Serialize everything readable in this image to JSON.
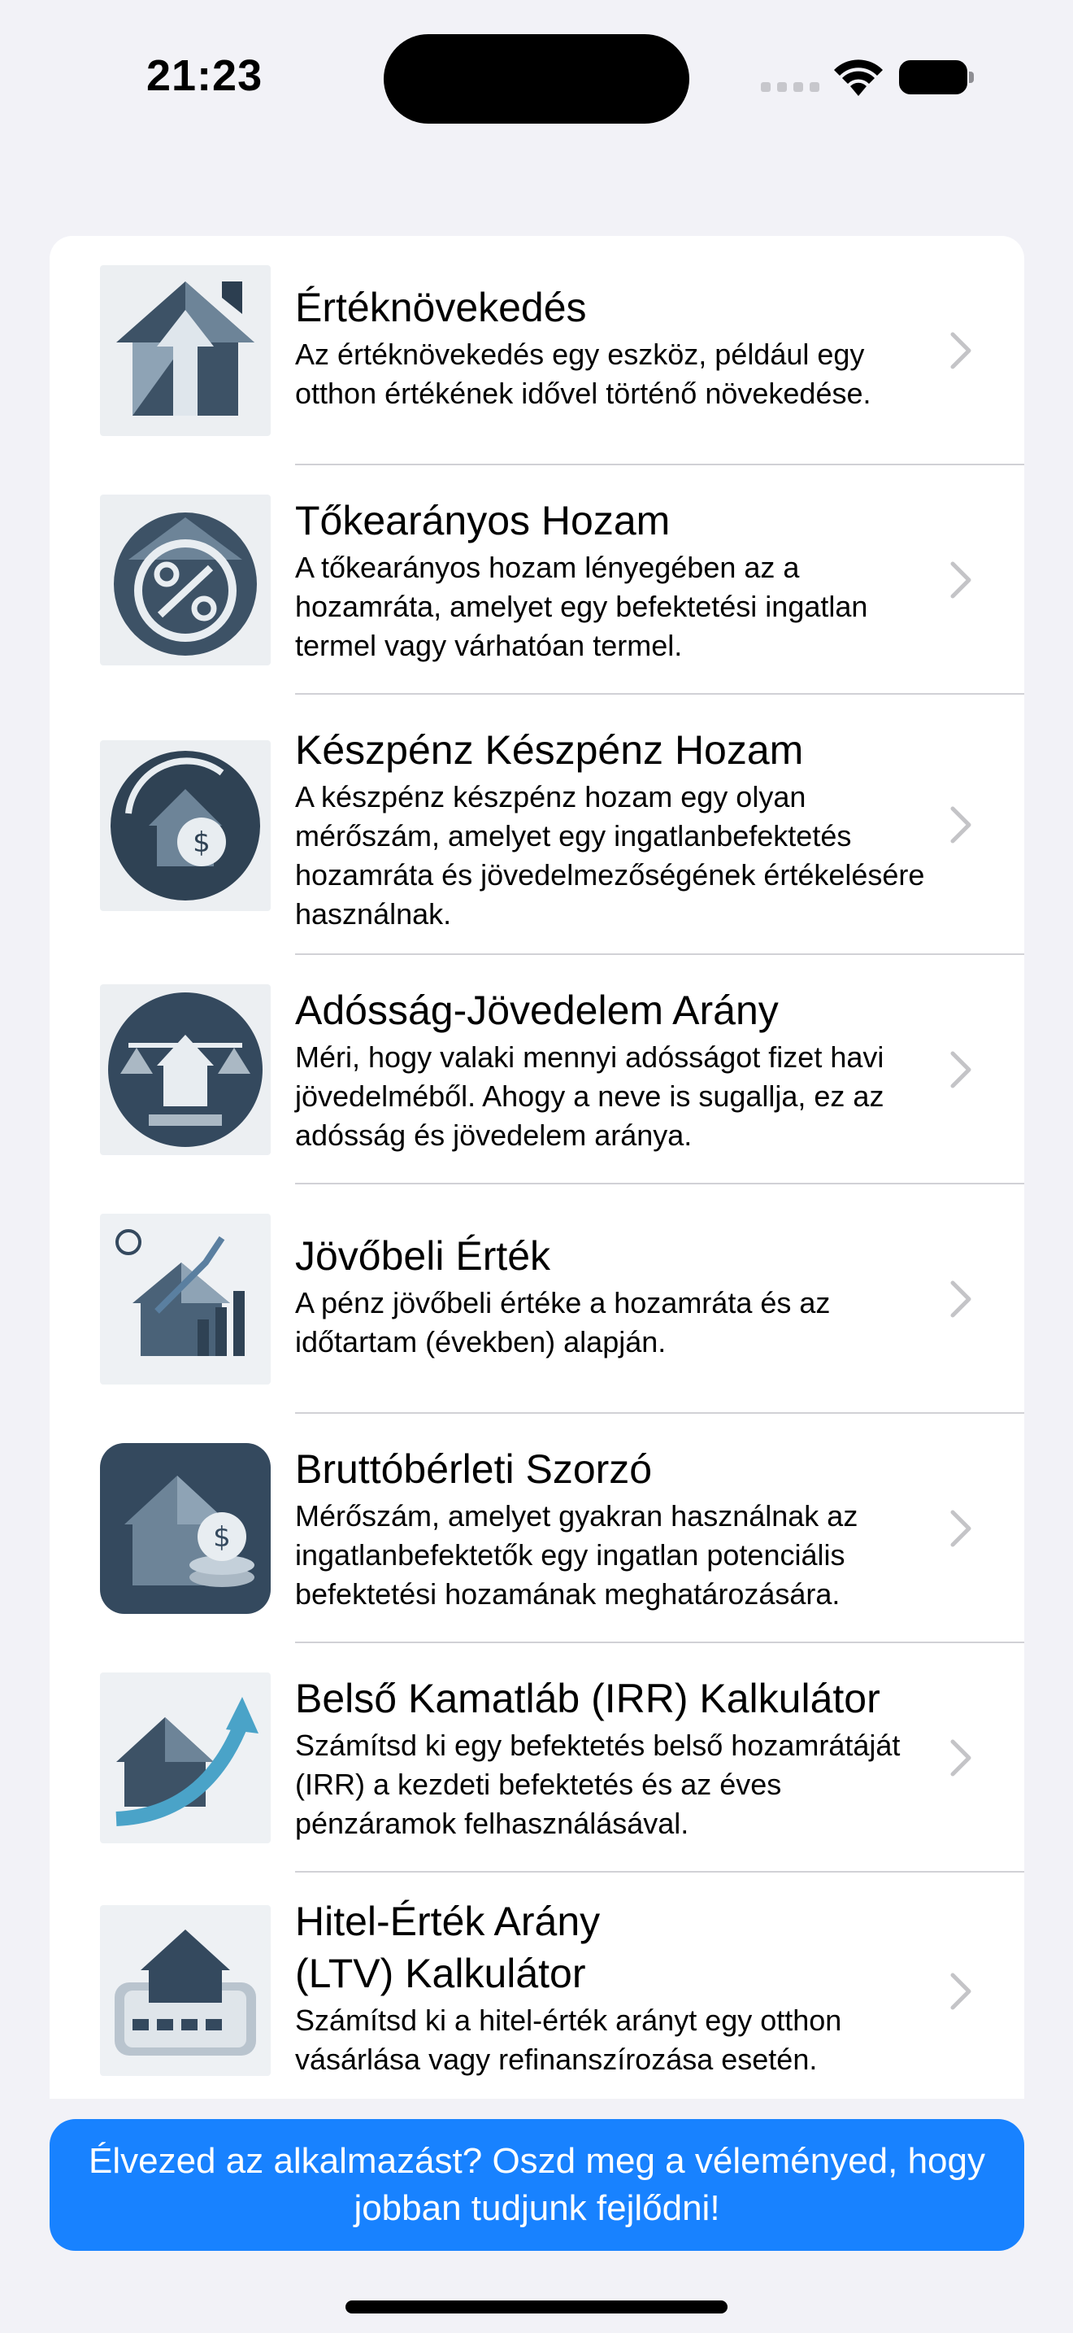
{
  "status": {
    "time": "21:23"
  },
  "items": [
    {
      "title": "Értéknövekedés",
      "desc": "Az értéknövekedés egy eszköz, például egy otthon értékének idővel történő növekedése.",
      "icon": "house-arrow-up-icon"
    },
    {
      "title": "Tőkearányos Hozam",
      "desc": "A tőkearányos hozam lényegében az a hozamráta, amelyet egy befektetési ingatlan termel vagy várhatóan termel.",
      "icon": "percent-house-icon"
    },
    {
      "title": "Készpénz Készpénz Hozam",
      "desc": "A készpénz készpénz hozam egy olyan mérőszám, amelyet egy ingatlanbefektetés hozamráta és jövedelmezőségének értékelésére használnak.",
      "icon": "cash-cycle-house-icon"
    },
    {
      "title": "Adósság-Jövedelem Arány",
      "desc": "Méri, hogy valaki mennyi adósságot fizet havi jövedelméből. Ahogy a neve is sugallja, ez az adósság és jövedelem aránya.",
      "icon": "scales-house-icon"
    },
    {
      "title": "Jövőbeli Érték",
      "desc": "A pénz jövőbeli értéke a hozamráta és az időtartam (években) alapján.",
      "icon": "house-growth-chart-icon"
    },
    {
      "title": "Bruttóbérleti Szorzó",
      "desc": "Mérőszám, amelyet gyakran használnak az ingatlanbefektetők egy ingatlan potenciális befektetési hozamának meghatározására.",
      "icon": "house-coins-icon"
    },
    {
      "title": "Belső Kamatláb (IRR) Kalkulátor",
      "desc": "Számítsd ki egy befektetés belső hozamrátáját (IRR) a kezdeti befektetés és az éves pénzáramok felhasználásával.",
      "icon": "house-trend-arrow-icon"
    },
    {
      "title": "Hitel-Érték Arány\n(LTV) Kalkulátor",
      "desc": "Számítsd ki a hitel-érték arányt egy otthon vásárlása vagy refinanszírozása esetén.",
      "icon": "house-calculator-icon"
    }
  ],
  "feedback": {
    "label": "Élvezed az alkalmazást? Oszd meg a véleményed, hogy jobban tudjunk fejlődni!"
  },
  "colors": {
    "accent": "#1882ff",
    "background": "#f2f2f7"
  }
}
